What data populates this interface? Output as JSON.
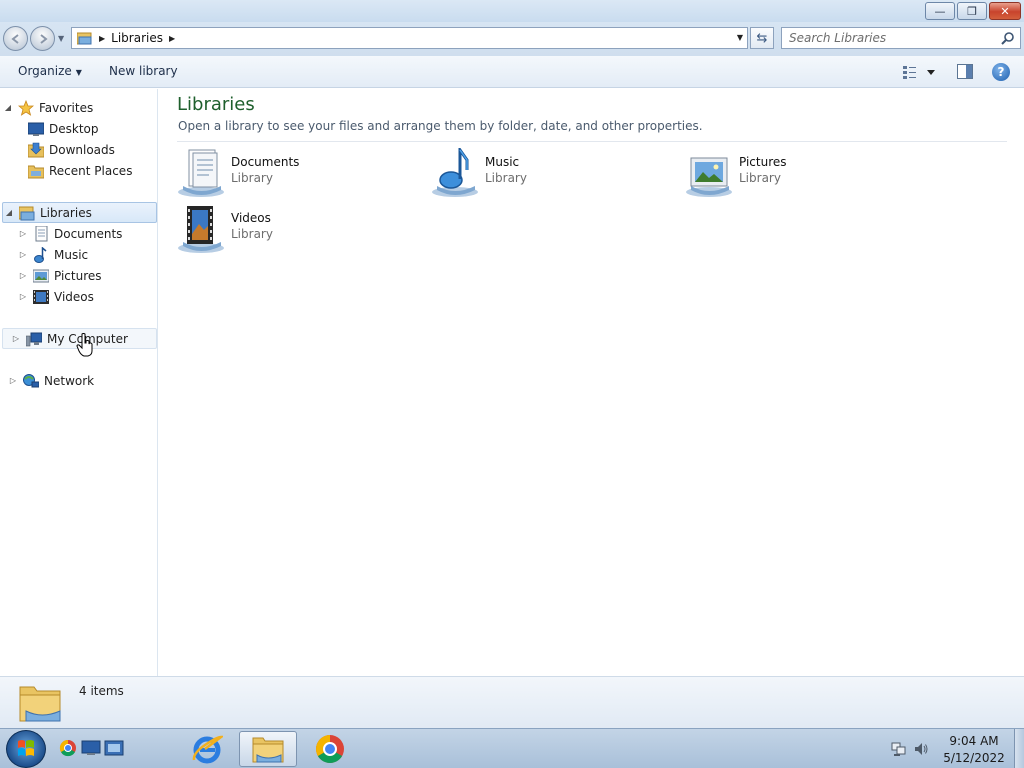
{
  "window": {
    "controls": {
      "minimize": "—",
      "maximize": "❐",
      "close": "✕"
    }
  },
  "address": {
    "breadcrumb": "Libraries",
    "search_placeholder": "Search Libraries"
  },
  "toolbar": {
    "organize_label": "Organize",
    "new_library_label": "New library"
  },
  "nav": {
    "favorites": {
      "label": "Favorites",
      "items": [
        {
          "label": "Desktop",
          "icon": "desktop-icon"
        },
        {
          "label": "Downloads",
          "icon": "downloads-folder-icon"
        },
        {
          "label": "Recent Places",
          "icon": "recent-places-icon"
        }
      ]
    },
    "libraries": {
      "label": "Libraries",
      "items": [
        {
          "label": "Documents",
          "icon": "documents-icon"
        },
        {
          "label": "Music",
          "icon": "music-icon"
        },
        {
          "label": "Pictures",
          "icon": "pictures-icon"
        },
        {
          "label": "Videos",
          "icon": "videos-icon"
        }
      ]
    },
    "computer": {
      "label": "My Computer"
    },
    "network": {
      "label": "Network"
    }
  },
  "content": {
    "title": "Libraries",
    "subtitle": "Open a library to see your files and arrange them by folder, date, and other properties.",
    "libraries": [
      {
        "name": "Documents",
        "type": "Library",
        "icon": "documents-library-icon"
      },
      {
        "name": "Music",
        "type": "Library",
        "icon": "music-library-icon"
      },
      {
        "name": "Pictures",
        "type": "Library",
        "icon": "pictures-library-icon"
      },
      {
        "name": "Videos",
        "type": "Library",
        "icon": "videos-library-icon"
      }
    ]
  },
  "details": {
    "count_text": "4 items"
  },
  "taskbar": {
    "time": "9:04 AM",
    "date": "5/12/2022"
  },
  "colors": {
    "title_green": "#1e5f2c",
    "selection_bg": "#d8e8f8",
    "taskbar": "#a9c0d9"
  }
}
